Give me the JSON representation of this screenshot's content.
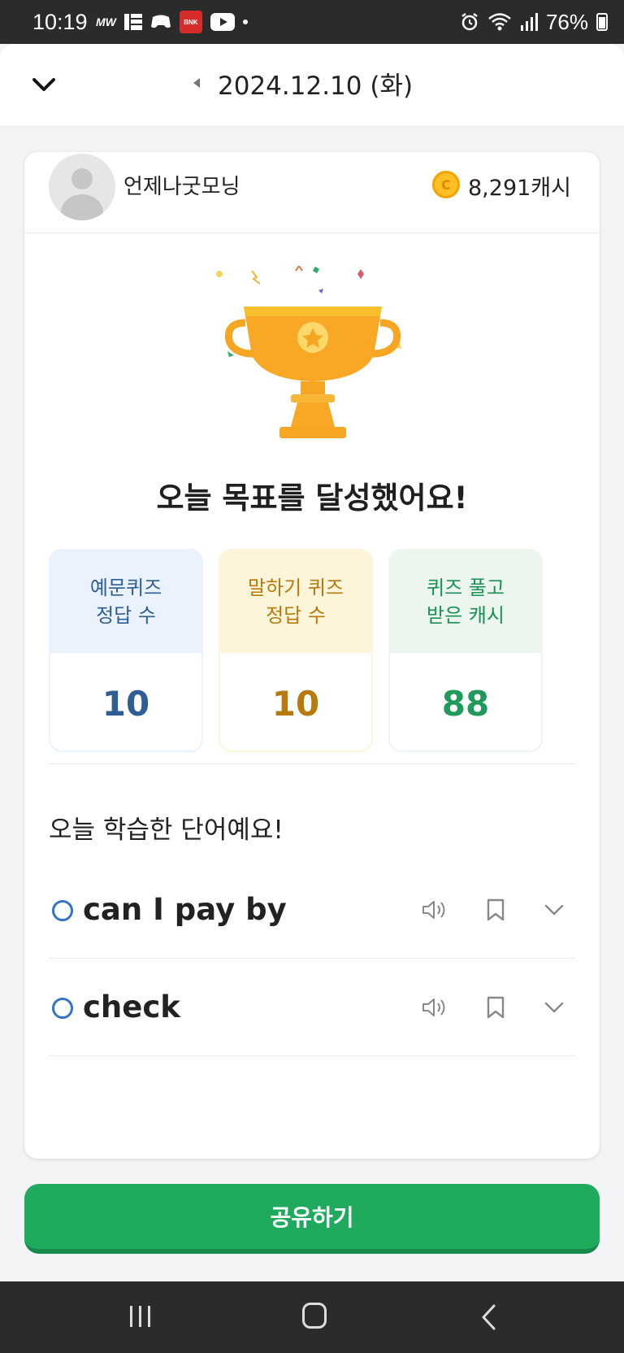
{
  "status_bar": {
    "time": "10:19",
    "left_icons": [
      "mw-icon",
      "news-grid-icon",
      "game-icon",
      "bnk-bank-icon",
      "youtube-icon",
      "dot-icon"
    ],
    "mw_label": "MW",
    "bnk_label": "BNK",
    "battery": "76%",
    "right_icons": [
      "alarm-icon",
      "wifi-icon",
      "signal-icon",
      "battery-icon"
    ]
  },
  "header": {
    "date": "2024.12.10 (화)"
  },
  "profile": {
    "username": "언제나굿모닝",
    "coin_symbol": "C",
    "cash": "8,291캐시"
  },
  "goal_title": "오늘 목표를 달성했어요!",
  "stats": [
    {
      "line1": "예문퀴즈",
      "line2": "정답 수",
      "value": "10",
      "color": "#2e5e95"
    },
    {
      "line1": "말하기 퀴즈",
      "line2": "정답 수",
      "value": "10",
      "color": "#b8790d"
    },
    {
      "line1": "퀴즈 풀고",
      "line2": "받은 캐시",
      "value": "88",
      "color": "#1f9a5b"
    }
  ],
  "words_title": "오늘 학습한 단어예요!",
  "words": [
    {
      "text": "can I pay by"
    },
    {
      "text": "check"
    }
  ],
  "share_button": "공유하기",
  "colors": {
    "accent_green": "#1faa5e",
    "word_circle": "#3573c9",
    "trophy": "#f9a825"
  }
}
